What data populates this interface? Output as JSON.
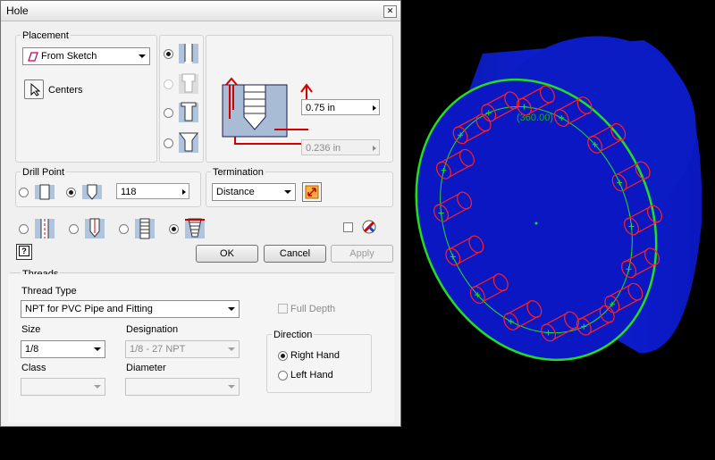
{
  "dialog": {
    "title": "Hole",
    "close_icon": "close-x-icon",
    "placement": {
      "label": "Placement",
      "mode": "From Sketch",
      "centers_label": "Centers"
    },
    "hole_types": [
      "simple-drill",
      "counterbore",
      "spotface",
      "countersink"
    ],
    "dimensions": {
      "diameter": "0.75 in",
      "depth": "0.236 in"
    },
    "drill_point": {
      "label": "Drill Point",
      "angle": "118"
    },
    "termination": {
      "label": "Termination",
      "value": "Distance"
    },
    "buttons": {
      "ok": "OK",
      "cancel": "Cancel",
      "apply": "Apply",
      "help": "?"
    },
    "threads": {
      "label": "Threads",
      "type_label": "Thread Type",
      "type_value": "NPT for PVC Pipe and Fitting",
      "full_depth": "Full Depth",
      "size_label": "Size",
      "size_value": "1/8",
      "designation_label": "Designation",
      "designation_value": "1/8 - 27 NPT",
      "class_label": "Class",
      "class_value": "",
      "diameter_label": "Diameter",
      "diameter_value": "",
      "direction": {
        "label": "Direction",
        "right": "Right Hand",
        "left": "Left Hand"
      }
    }
  },
  "viewport": {
    "angle_label": "(360.00)",
    "part_color": "#0a18c8",
    "edge_color": "#22dd22",
    "hole_color": "#ff2020",
    "hole_count": 16
  },
  "colors": {
    "dialog_bg": "#f0f0f0",
    "dimension_red": "#d40000"
  }
}
